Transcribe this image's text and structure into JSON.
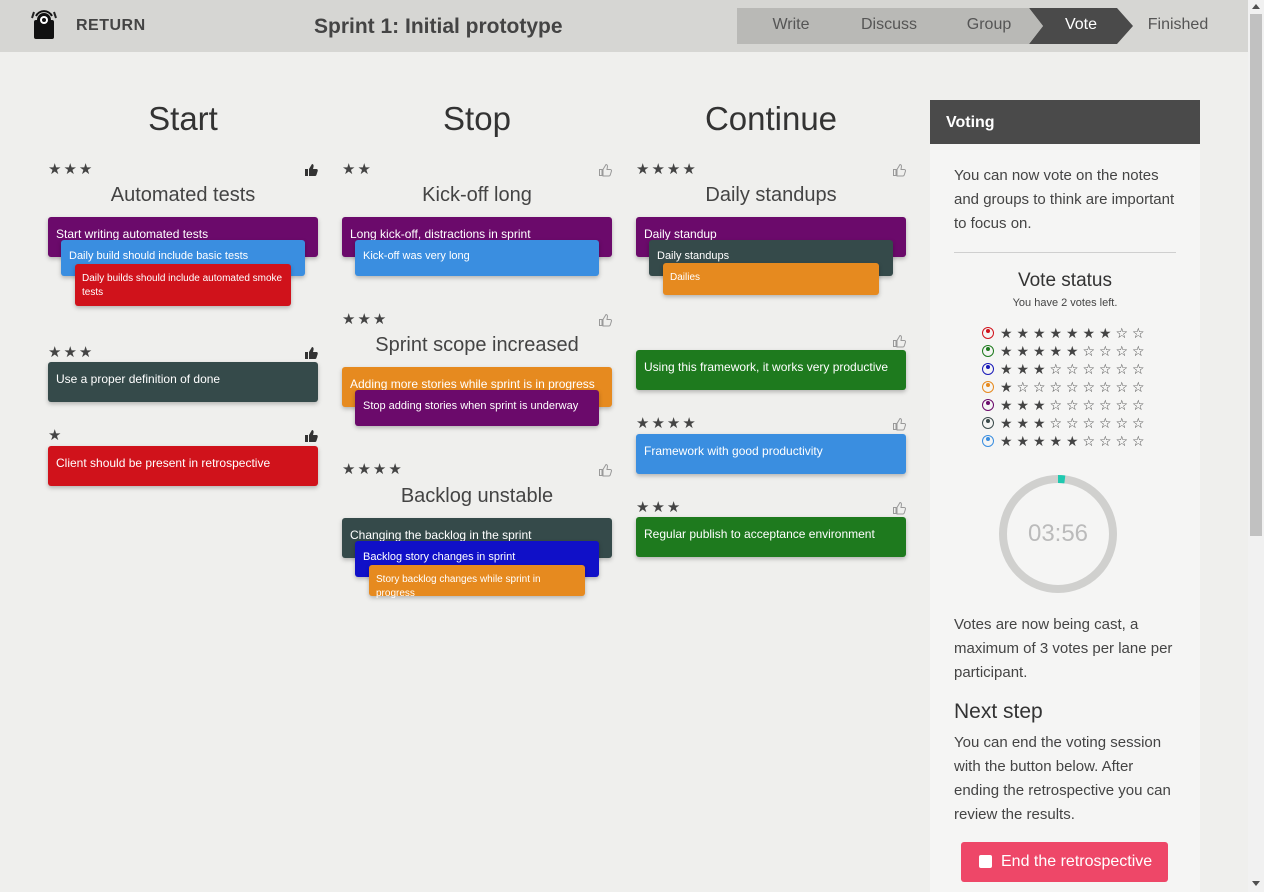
{
  "header": {
    "return_label": "RETURN",
    "title": "Sprint 1: Initial prototype",
    "steps": [
      "Write",
      "Discuss",
      "Group",
      "Vote",
      "Finished"
    ],
    "active_step": "Vote"
  },
  "lanes": [
    {
      "title": "Start"
    },
    {
      "title": "Stop"
    },
    {
      "title": "Continue"
    }
  ],
  "groups": {
    "start_1": {
      "stars": "★★★",
      "title": "Automated tests",
      "notes": [
        "Start writing automated tests",
        "Daily build should include basic tests",
        "Daily builds should include automated smoke tests"
      ]
    },
    "start_2": {
      "stars": "★★★",
      "notes": [
        "Use a proper definition of done"
      ]
    },
    "start_3": {
      "stars": "★",
      "notes": [
        "Client should be present in retrospective"
      ]
    },
    "stop_1": {
      "stars": "★★",
      "title": "Kick-off long",
      "notes": [
        "Long kick-off, distractions in sprint",
        "Kick-off was very long"
      ]
    },
    "stop_2": {
      "stars": "★★★",
      "title": "Sprint scope increased",
      "notes": [
        "Adding more stories while sprint is in progress",
        "Stop adding stories when sprint is underway"
      ]
    },
    "stop_3": {
      "stars": "★★★★",
      "title": "Backlog unstable",
      "notes": [
        "Changing the backlog in the sprint",
        "Backlog story changes in sprint",
        "Story backlog changes while sprint in progress"
      ]
    },
    "cont_1": {
      "stars": "★★★★",
      "title": "Daily standups",
      "notes": [
        "Daily standup",
        "Daily standups",
        "Dailies"
      ]
    },
    "cont_2": {
      "stars": "",
      "notes": [
        "Using this framework, it works very productive"
      ]
    },
    "cont_3": {
      "stars": "★★★★",
      "notes": [
        "Framework with good productivity"
      ]
    },
    "cont_4": {
      "stars": "★★★",
      "notes": [
        "Regular publish to acceptance environment"
      ]
    }
  },
  "panel": {
    "title": "Voting",
    "intro": "You can now vote on the notes and groups to think are important to focus on.",
    "vote_status_title": "Vote status",
    "votes_left": "You have 2 votes left.",
    "participants": [
      {
        "color": "#d0121b",
        "votes": 7
      },
      {
        "color": "#1e7a1e",
        "votes": 5
      },
      {
        "color": "#1a1ab8",
        "votes": 3
      },
      {
        "color": "#e68a1f",
        "votes": 1
      },
      {
        "color": "#6b0a6b",
        "votes": 3
      },
      {
        "color": "#3a4a4a",
        "votes": 3
      },
      {
        "color": "#3a8ee0",
        "votes": 5
      }
    ],
    "max_votes": 9,
    "timer": "03:56",
    "timer_progress": 0.02,
    "cast_text": "Votes are now being cast, a maximum of 3 votes per lane per participant.",
    "next_step_title": "Next step",
    "next_step_text": "You can end the voting session with the button below. After ending the retrospective you can review the results.",
    "end_button": "End the retrospective"
  },
  "colors": {
    "purple": "#6b0a6b",
    "blue": "#3a8ee0",
    "red": "#d0121b",
    "dark": "#354a4a",
    "orange": "#e68a1f",
    "green": "#1e7a1e",
    "navy": "#1010c8",
    "accent": "#ee4768",
    "timer_teal": "#1fc9b0"
  }
}
